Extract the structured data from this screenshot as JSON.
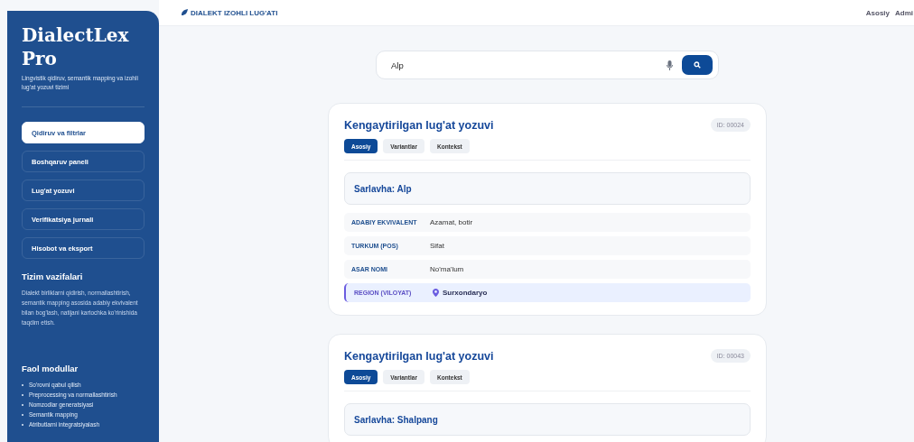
{
  "sidebar": {
    "title": "DialectLex Pro",
    "subtitle": "Lingvistik qidiruv, semantik mapping va izohli lug'at yozuvi tizimi",
    "items": [
      {
        "label": "Qidiruv va filtrlar",
        "selected": true
      },
      {
        "label": "Boshqaruv paneli",
        "selected": false
      },
      {
        "label": "Lug'at yozuvi",
        "selected": false
      },
      {
        "label": "Verifikatsiya jurnali",
        "selected": false
      },
      {
        "label": "Hisobot va eksport",
        "selected": false
      }
    ],
    "tasks": {
      "heading": "Tizim vazifalari",
      "text": "Dialekt birliklarni qidirish, normallashtirish, semantik mapping asosida adabiy ekvivalent bilan bog'lash, natijani kartochka ko'rinishida taqdim etish."
    },
    "modules": {
      "heading": "Faol modullar",
      "items": [
        "So'rovni qabul qilish",
        "Preprocessing va normallashtirish",
        "Nomzodlar generatsiyasi",
        "Semantik mapping",
        "Atributlarni integratsiyalash"
      ]
    }
  },
  "header": {
    "brand": "DIALEKT IZOHLI LUG'ATI",
    "nav": [
      "Asosiy",
      "Admi"
    ]
  },
  "search": {
    "value": "Alp"
  },
  "cards": [
    {
      "title": "Kengaytirilgan lug'at yozuvi",
      "id": "ID: 00024",
      "tabs": [
        {
          "label": "Asosiy",
          "selected": true
        },
        {
          "label": "Variantlar",
          "selected": false
        },
        {
          "label": "Kontekst",
          "selected": false
        }
      ],
      "heading": "Sarlavha: Alp",
      "fields": [
        {
          "kind": "plain",
          "label": "ADABIY EKVIVALENT",
          "value": "Azamat, botir"
        },
        {
          "kind": "plain",
          "label": "TURKUM (POS)",
          "value": "Sifat"
        },
        {
          "kind": "plain",
          "label": "ASAR NOMI",
          "value": "No'ma'lum"
        },
        {
          "kind": "region",
          "label": "REGION (VILOYAT)",
          "value": "Surxondaryo"
        }
      ]
    },
    {
      "title": "Kengaytirilgan lug'at yozuvi",
      "id": "ID: 00043",
      "tabs": [
        {
          "label": "Asosiy",
          "selected": true
        },
        {
          "label": "Variantlar",
          "selected": false
        },
        {
          "label": "Kontekst",
          "selected": false
        }
      ],
      "heading": "Sarlavha: Shalpang"
    }
  ]
}
